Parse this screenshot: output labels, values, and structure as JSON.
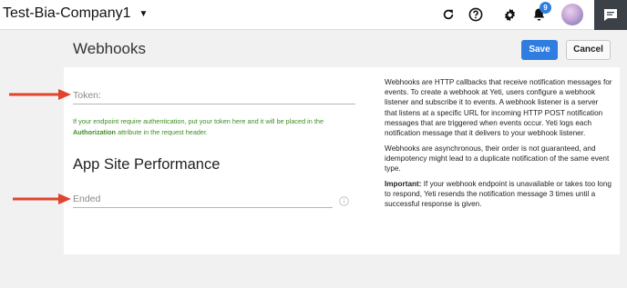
{
  "topbar": {
    "company_name": "Test-Bia-Company1",
    "notification_count": "9",
    "icons": [
      "refresh-icon",
      "help-icon",
      "gear-icon",
      "bell-icon",
      "chat-icon"
    ]
  },
  "header": {
    "title": "Webhooks",
    "save_label": "Save",
    "cancel_label": "Cancel"
  },
  "form": {
    "token_placeholder": "Token:",
    "hint_prefix": "If your endpoint require authentication, put your token here and it will be placed in the",
    "hint_bold": "Authorization",
    "hint_suffix": "attribute in the request header.",
    "section_title": "App Site Performance",
    "ended_placeholder": "Ended"
  },
  "description": {
    "p1": "Webhooks are HTTP callbacks that receive notification messages for events. To create a webhook at Yeti, users configure a webhook listener and subscribe it to events. A webhook listener is a server that listens at a specific URL for incoming HTTP POST notification messages that are triggered when events occur. Yeti logs each notification message that it delivers to your webhook listener.",
    "p2": "Webhooks are asynchronous, their order is not guaranteed, and idempotency might lead to a duplicate notification of the same event type.",
    "p3_bold": "Important:",
    "p3": "If your webhook endpoint is unavailable or takes too long to respond, Yeti resends the notification message 3 times until a successful response is given."
  },
  "colors": {
    "primary": "#2f7de1",
    "hint_green": "#3e8e23",
    "annotation_arrow": "#e0442c",
    "chat_bg": "#3c4147"
  }
}
